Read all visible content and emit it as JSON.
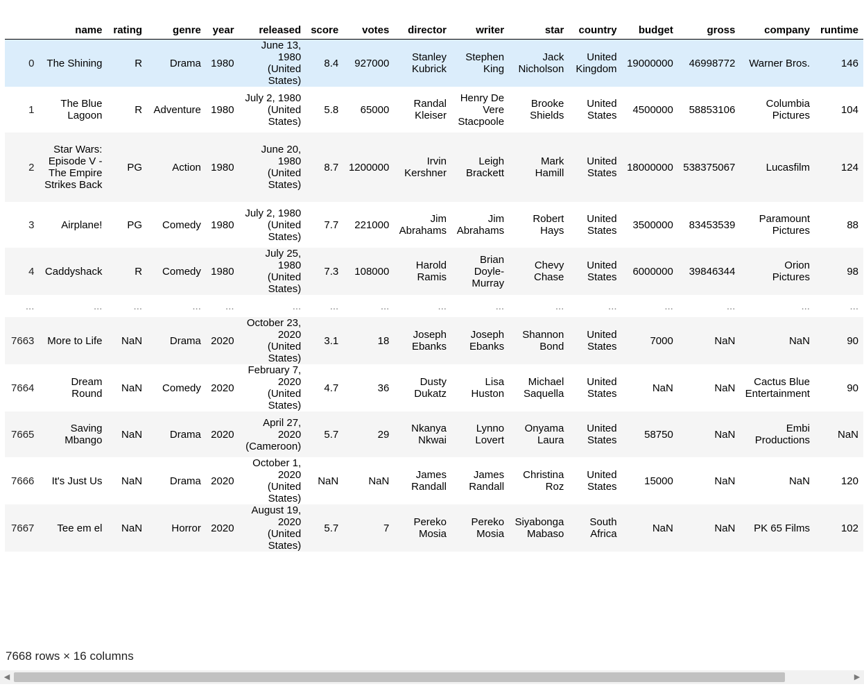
{
  "columns": [
    "",
    "name",
    "rating",
    "genre",
    "year",
    "released",
    "score",
    "votes",
    "director",
    "writer",
    "star",
    "country",
    "budget",
    "gross",
    "company",
    "runtime"
  ],
  "rows": [
    [
      "0",
      "The Shining",
      "R",
      "Drama",
      "1980",
      "June 13, 1980 (United States)",
      "8.4",
      "927000",
      "Stanley Kubrick",
      "Stephen King",
      "Jack Nicholson",
      "United Kingdom",
      "19000000",
      "46998772",
      "Warner Bros.",
      "146"
    ],
    [
      "1",
      "The Blue Lagoon",
      "R",
      "Adventure",
      "1980",
      "July 2, 1980 (United States)",
      "5.8",
      "65000",
      "Randal Kleiser",
      "Henry De Vere Stacpoole",
      "Brooke Shields",
      "United States",
      "4500000",
      "58853106",
      "Columbia Pictures",
      "104"
    ],
    [
      "2",
      "Star Wars: Episode V - The Empire Strikes Back",
      "PG",
      "Action",
      "1980",
      "June 20, 1980 (United States)",
      "8.7",
      "1200000",
      "Irvin Kershner",
      "Leigh Brackett",
      "Mark Hamill",
      "United States",
      "18000000",
      "538375067",
      "Lucasfilm",
      "124"
    ],
    [
      "3",
      "Airplane!",
      "PG",
      "Comedy",
      "1980",
      "July 2, 1980 (United States)",
      "7.7",
      "221000",
      "Jim Abrahams",
      "Jim Abrahams",
      "Robert Hays",
      "United States",
      "3500000",
      "83453539",
      "Paramount Pictures",
      "88"
    ],
    [
      "4",
      "Caddyshack",
      "R",
      "Comedy",
      "1980",
      "July 25, 1980 (United States)",
      "7.3",
      "108000",
      "Harold Ramis",
      "Brian Doyle-Murray",
      "Chevy Chase",
      "United States",
      "6000000",
      "39846344",
      "Orion Pictures",
      "98"
    ],
    [
      "...",
      "...",
      "...",
      "...",
      "...",
      "...",
      "...",
      "...",
      "...",
      "...",
      "...",
      "...",
      "...",
      "...",
      "...",
      "..."
    ],
    [
      "7663",
      "More to Life",
      "NaN",
      "Drama",
      "2020",
      "October 23, 2020 (United States)",
      "3.1",
      "18",
      "Joseph Ebanks",
      "Joseph Ebanks",
      "Shannon Bond",
      "United States",
      "7000",
      "NaN",
      "NaN",
      "90"
    ],
    [
      "7664",
      "Dream Round",
      "NaN",
      "Comedy",
      "2020",
      "February 7, 2020 (United States)",
      "4.7",
      "36",
      "Dusty Dukatz",
      "Lisa Huston",
      "Michael Saquella",
      "United States",
      "NaN",
      "NaN",
      "Cactus Blue Entertainment",
      "90"
    ],
    [
      "7665",
      "Saving Mbango",
      "NaN",
      "Drama",
      "2020",
      "April 27, 2020 (Cameroon)",
      "5.7",
      "29",
      "Nkanya Nkwai",
      "Lynno Lovert",
      "Onyama Laura",
      "United States",
      "58750",
      "NaN",
      "Embi Productions",
      "NaN"
    ],
    [
      "7666",
      "It's Just Us",
      "NaN",
      "Drama",
      "2020",
      "October 1, 2020 (United States)",
      "NaN",
      "NaN",
      "James Randall",
      "James Randall",
      "Christina Roz",
      "United States",
      "15000",
      "NaN",
      "NaN",
      "120"
    ],
    [
      "7667",
      "Tee em el",
      "NaN",
      "Horror",
      "2020",
      "August 19, 2020 (United States)",
      "5.7",
      "7",
      "Pereko Mosia",
      "Pereko Mosia",
      "Siyabonga Mabaso",
      "South Africa",
      "NaN",
      "NaN",
      "PK 65 Films",
      "102"
    ]
  ],
  "footer": "7668 rows × 16 columns",
  "scrollbar": {
    "left_arrow": "◀",
    "right_arrow": "▶"
  }
}
